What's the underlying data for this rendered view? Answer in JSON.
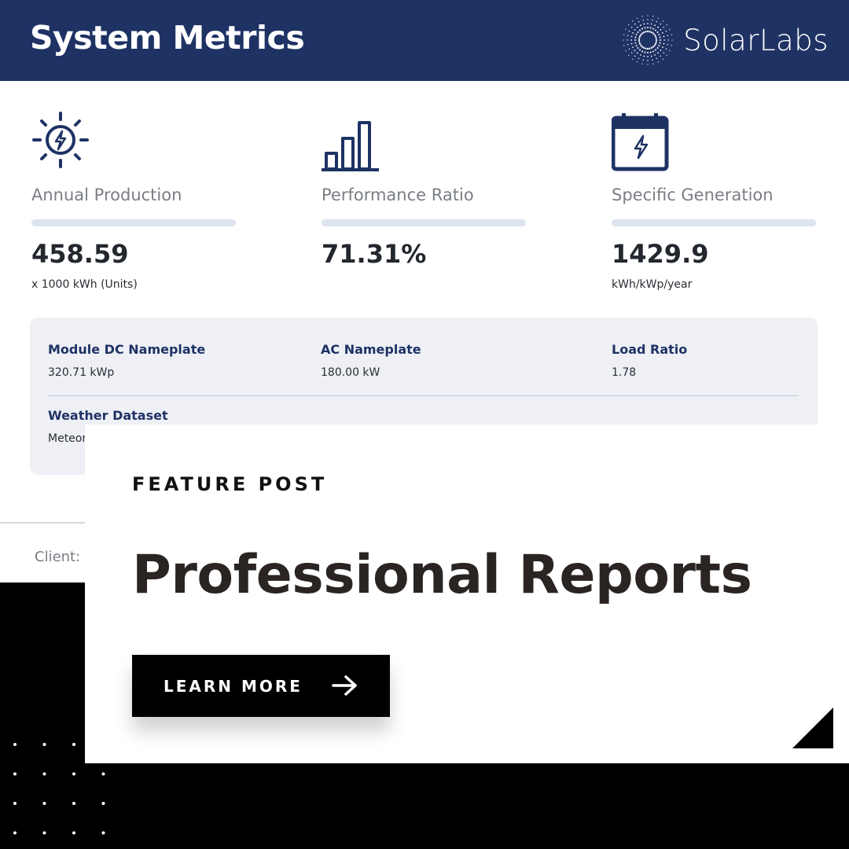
{
  "header": {
    "title": "System Metrics",
    "brand": "SolarLabs"
  },
  "metrics": [
    {
      "icon": "sun-bolt-icon",
      "label": "Annual Production",
      "value": "458.59",
      "unit": "x 1000 kWh (Units)"
    },
    {
      "icon": "bar-chart-icon",
      "label": "Performance Ratio",
      "value": "71.31%",
      "unit": ""
    },
    {
      "icon": "calendar-bolt-icon",
      "label": "Specific Generation",
      "value": "1429.9",
      "unit": "kWh/kWp/year"
    }
  ],
  "details": {
    "module_dc": {
      "label": "Module DC Nameplate",
      "value": "320.71 kWp"
    },
    "ac": {
      "label": "AC Nameplate",
      "value": "180.00 kW"
    },
    "load_ratio": {
      "label": "Load Ratio",
      "value": "1.78"
    },
    "weather": {
      "label": "Weather Dataset",
      "value": "Meteor"
    }
  },
  "client": "Client: V",
  "feature": {
    "eyebrow": "FEATURE POST",
    "title": "Professional Reports",
    "cta_label": "LEARN MORE",
    "cta_icon": "arrow-right-icon"
  },
  "colors": {
    "navy": "#1e3264",
    "panel": "#eef0f6",
    "black": "#000000"
  }
}
